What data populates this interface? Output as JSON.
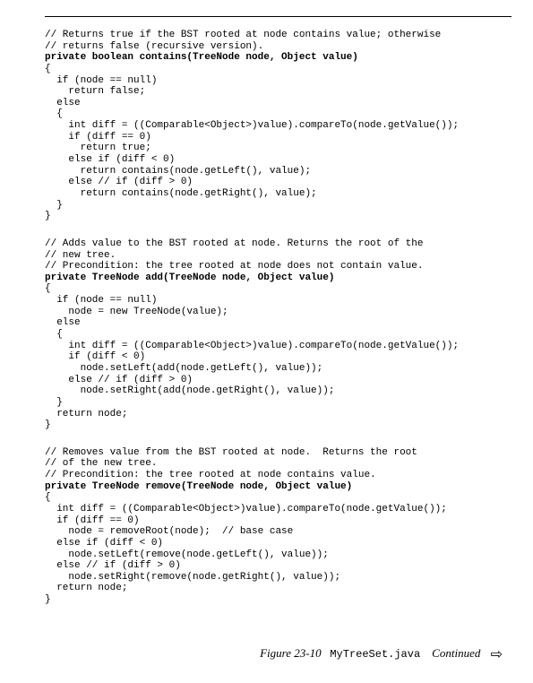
{
  "code": {
    "contains": {
      "c1": "// Returns true if the BST rooted at node contains value; otherwise",
      "c2": "// returns false (recursive version).",
      "sig": "private boolean contains(TreeNode node, Object value)",
      "l1": "{",
      "l2": "  if (node == null)",
      "l3": "    return false;",
      "l4": "  else",
      "l5": "  {",
      "l6": "    int diff = ((Comparable<Object>)value).compareTo(node.getValue());",
      "l7": "    if (diff == 0)",
      "l8": "      return true;",
      "l9": "    else if (diff < 0)",
      "l10": "      return contains(node.getLeft(), value);",
      "l11": "    else // if (diff > 0)",
      "l12": "      return contains(node.getRight(), value);",
      "l13": "  }",
      "l14": "}"
    },
    "add": {
      "c1": "// Adds value to the BST rooted at node. Returns the root of the",
      "c2": "// new tree.",
      "c3": "// Precondition: the tree rooted at node does not contain value.",
      "sig": "private TreeNode add(TreeNode node, Object value)",
      "l1": "{",
      "l2": "  if (node == null)",
      "l3": "    node = new TreeNode(value);",
      "l4": "  else",
      "l5": "  {",
      "l6": "    int diff = ((Comparable<Object>)value).compareTo(node.getValue());",
      "l7": "    if (diff < 0)",
      "l8": "      node.setLeft(add(node.getLeft(), value));",
      "l9": "    else // if (diff > 0)",
      "l10": "      node.setRight(add(node.getRight(), value));",
      "l11": "  }",
      "l12": "  return node;",
      "l13": "}"
    },
    "remove": {
      "c1": "// Removes value from the BST rooted at node.  Returns the root",
      "c2": "// of the new tree.",
      "c3": "// Precondition: the tree rooted at node contains value.",
      "sig": "private TreeNode remove(TreeNode node, Object value)",
      "l1": "{",
      "l2": "  int diff = ((Comparable<Object>)value).compareTo(node.getValue());",
      "l3": "  if (diff == 0)",
      "l4": "    node = removeRoot(node);  // base case",
      "l5": "  else if (diff < 0)",
      "l6": "    node.setLeft(remove(node.getLeft(), value));",
      "l7": "  else // if (diff > 0)",
      "l8": "    node.setRight(remove(node.getRight(), value));",
      "l9": "  return node;",
      "l10": "}"
    }
  },
  "caption": {
    "figlabel": "Figure 23-10",
    "filename": "MyTreeSet.java",
    "cont": "Continued",
    "arrow": "⇨"
  }
}
